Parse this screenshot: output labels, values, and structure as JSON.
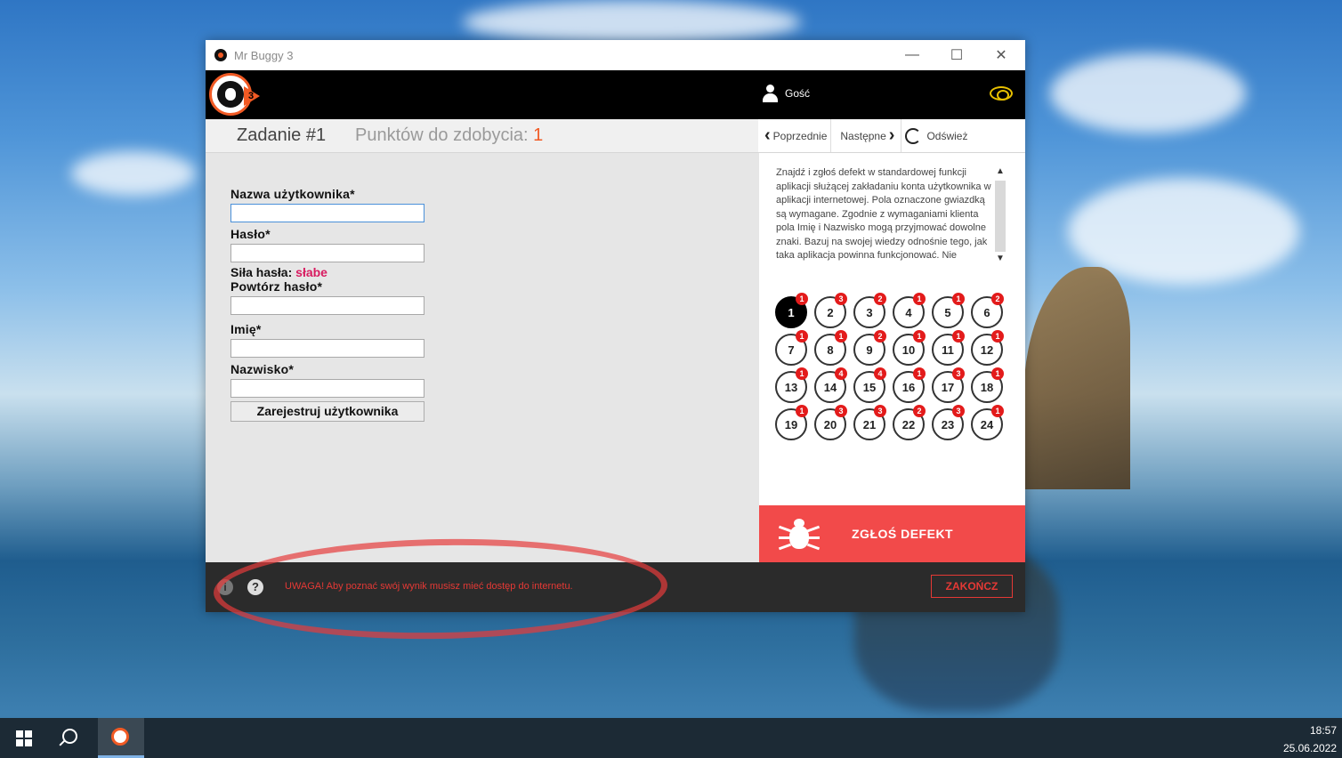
{
  "window": {
    "title": "Mr Buggy 3",
    "controls": {
      "minimize": "—",
      "maximize": "☐",
      "close": "✕"
    }
  },
  "header": {
    "logo_number": "3",
    "user_label": "Gość"
  },
  "task": {
    "title": "Zadanie #1",
    "points_label": "Punktów do zdobycia:",
    "points_value": "1"
  },
  "nav": {
    "previous": "Poprzednie",
    "next": "Następne",
    "refresh": "Odśwież"
  },
  "form": {
    "username_label": "Nazwa użytkownika*",
    "password_label": "Hasło*",
    "strength_label": "Siła hasła:",
    "strength_value": "słabe",
    "repeat_password_label": "Powtórz hasło*",
    "first_name_label": "Imię*",
    "last_name_label": "Nazwisko*",
    "submit_label": "Zarejestruj użytkownika"
  },
  "description": "Znajdź i zgłoś defekt w standardowej funkcji aplikacji służącej zakładaniu konta użytkownika w aplikacji internetowej. Pola oznaczone gwiazdką są wymagane. Zgodnie z wymaganiami klienta pola Imię i Nazwisko mogą przyjmować dowolne znaki. Bazuj na swojej wiedzy odnośnie tego, jak taka aplikacja powinna funkcjonować. Nie",
  "tasks": [
    {
      "n": "1",
      "badge": "1",
      "active": true
    },
    {
      "n": "2",
      "badge": "3"
    },
    {
      "n": "3",
      "badge": "2"
    },
    {
      "n": "4",
      "badge": "1"
    },
    {
      "n": "5",
      "badge": "1"
    },
    {
      "n": "6",
      "badge": "2"
    },
    {
      "n": "7",
      "badge": "1"
    },
    {
      "n": "8",
      "badge": "1"
    },
    {
      "n": "9",
      "badge": "2"
    },
    {
      "n": "10",
      "badge": "1"
    },
    {
      "n": "11",
      "badge": "1"
    },
    {
      "n": "12",
      "badge": "1"
    },
    {
      "n": "13",
      "badge": "1"
    },
    {
      "n": "14",
      "badge": "4"
    },
    {
      "n": "15",
      "badge": "4"
    },
    {
      "n": "16",
      "badge": "1"
    },
    {
      "n": "17",
      "badge": "3"
    },
    {
      "n": "18",
      "badge": "1"
    },
    {
      "n": "19",
      "badge": "1"
    },
    {
      "n": "20",
      "badge": "3"
    },
    {
      "n": "21",
      "badge": "3"
    },
    {
      "n": "22",
      "badge": "2"
    },
    {
      "n": "23",
      "badge": "3"
    },
    {
      "n": "24",
      "badge": "1"
    }
  ],
  "report_button": "ZGŁOŚ DEFEKT",
  "footer": {
    "info": "i",
    "help": "?",
    "warning": "UWAGA! Aby poznać swój wynik musisz mieć dostęp do internetu.",
    "finish": "ZAKOŃCZ"
  },
  "clock": {
    "time": "18:57",
    "date": "25.06.2022"
  },
  "colors": {
    "accent": "#f15a24",
    "report": "#f24a4a",
    "warning": "#e53935",
    "badge": "#e31b1b"
  }
}
